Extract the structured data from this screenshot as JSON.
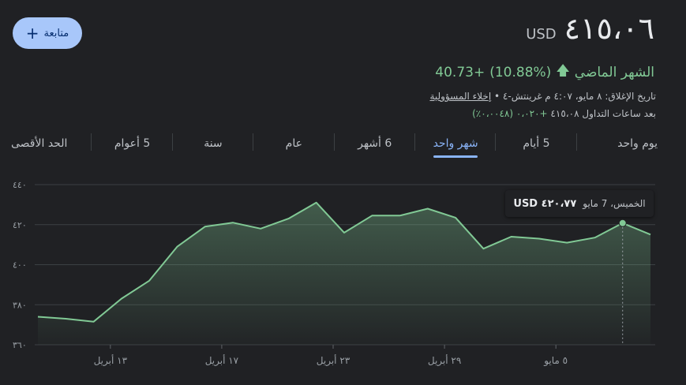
{
  "header": {
    "price": "٤١٥،٠٦",
    "currency": "USD",
    "follow_label": "متابعة",
    "follow_icon": "plus-icon"
  },
  "change": {
    "amount": "+40.73",
    "percent": "(10.88%)",
    "period": "الشهر الماضي",
    "direction_icon": "arrow-up-icon",
    "color": "#81c995"
  },
  "meta": {
    "close_text": "تاريخ الإغلاق: ٨ مايو، ٤:٠٧ م غرينتش-٤ •",
    "disclaimer": "إخلاء المسؤولية",
    "after_hours_label": "بعد ساعات التداول",
    "after_hours_price": "٤١٥،٠٨",
    "after_hours_change": "+٠،٠٢٠ (٠،٠٠٤٨٪)"
  },
  "tabs": [
    {
      "label": "يوم واحد",
      "active": false
    },
    {
      "label": "5 أيام",
      "active": false
    },
    {
      "label": "شهر واحد",
      "active": true
    },
    {
      "label": "6 أشهر",
      "active": false
    },
    {
      "label": "عام",
      "active": false
    },
    {
      "label": "سنة",
      "active": false
    },
    {
      "label": "5 أعوام",
      "active": false
    },
    {
      "label": "الحد الأقصى",
      "active": false
    }
  ],
  "tooltip": {
    "date": "الخميس، 7 مايو",
    "value": "٤٢٠،٧٧ USD"
  },
  "chart_data": {
    "type": "area",
    "x": [
      "Apr 9",
      "Apr 10",
      "Apr 11",
      "Apr 12",
      "Apr 15",
      "Apr 16",
      "Apr 17",
      "Apr 18",
      "Apr 19",
      "Apr 22",
      "Apr 23",
      "Apr 24",
      "Apr 25",
      "Apr 26",
      "Apr 29",
      "Apr 30",
      "May 1",
      "May 2",
      "May 3",
      "May 6",
      "May 7",
      "May 8"
    ],
    "values": [
      374,
      373,
      371.5,
      383,
      392,
      409,
      419,
      421,
      418,
      423,
      431,
      416,
      424.5,
      424.5,
      428,
      423.5,
      408,
      414,
      413,
      411,
      413.5,
      420.77,
      415.06
    ],
    "yticks": [
      "٤٤٠",
      "٤٢٠",
      "٤٠٠",
      "٣٨٠",
      "٣٦٠"
    ],
    "ytick_values": [
      440,
      420,
      400,
      380,
      360
    ],
    "xticks": [
      "١٣ أبريل",
      "١٧ أبريل",
      "٢٣ أبريل",
      "٢٩ أبريل",
      "٥ مايو"
    ],
    "ylim": [
      360,
      440
    ],
    "grid": true,
    "line_color": "#81c995",
    "highlight_index": 21
  }
}
